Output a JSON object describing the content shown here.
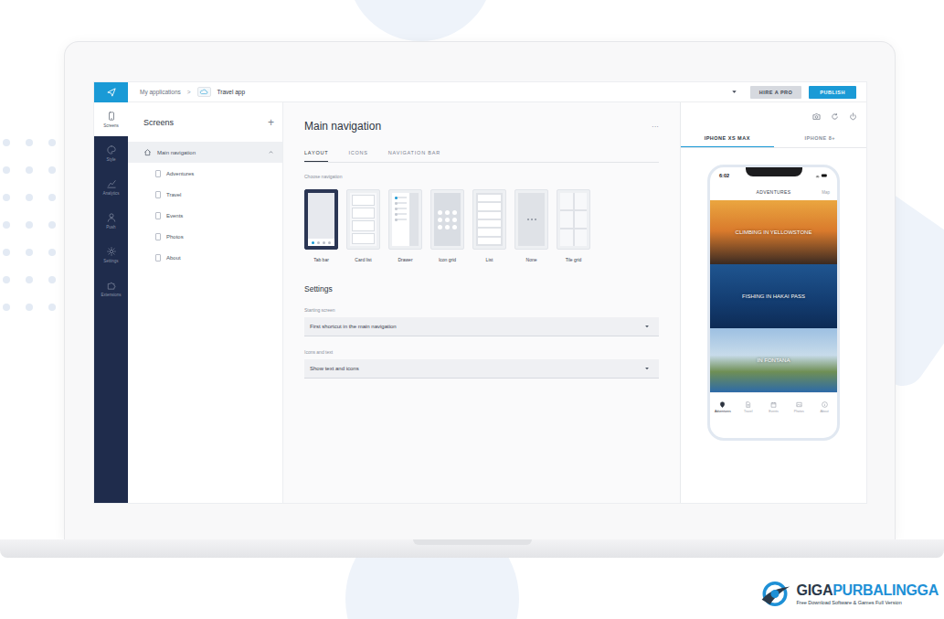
{
  "app": {
    "breadcrumb": [
      "My applications",
      "Travel app"
    ],
    "separator": ">",
    "buttons": [
      {
        "label": "HIRE A PRO",
        "kind": "secondary"
      },
      {
        "label": "PUBLISH",
        "kind": "primary"
      }
    ]
  },
  "sidebar": {
    "items": [
      {
        "label": "Screens",
        "selected": true
      },
      {
        "label": "Style",
        "selected": false
      },
      {
        "label": "Analytics",
        "selected": false
      },
      {
        "label": "Push",
        "selected": false
      },
      {
        "label": "Settings",
        "selected": false
      },
      {
        "label": "Extensions",
        "selected": false
      }
    ]
  },
  "screens": {
    "title": "Screens",
    "add": "+",
    "items": [
      {
        "label": "Main navigation",
        "kind": "root",
        "selected": true,
        "expanded": true
      },
      {
        "label": "Adventures",
        "kind": "child",
        "selected": false,
        "expanded": false
      },
      {
        "label": "Travel",
        "kind": "child",
        "selected": false,
        "expanded": false
      },
      {
        "label": "Events",
        "kind": "child",
        "selected": false,
        "expanded": false
      },
      {
        "label": "Photos",
        "kind": "child",
        "selected": false,
        "expanded": false
      },
      {
        "label": "About",
        "kind": "child",
        "selected": false,
        "expanded": false
      }
    ]
  },
  "editor": {
    "title": "Main navigation",
    "more": "···",
    "tabs": [
      {
        "label": "LAYOUT",
        "selected": true
      },
      {
        "label": "ICONS",
        "selected": false
      },
      {
        "label": "NAVIGATION BAR",
        "selected": false
      }
    ],
    "choose_label": "Choose navigation",
    "layouts": [
      {
        "label": "Tab bar",
        "kind": "tabbar",
        "selected": true
      },
      {
        "label": "Card list",
        "kind": "cardlist",
        "selected": false
      },
      {
        "label": "Drawer",
        "kind": "drawer",
        "selected": false
      },
      {
        "label": "Icon grid",
        "kind": "icongrid",
        "selected": false
      },
      {
        "label": "List",
        "kind": "list",
        "selected": false
      },
      {
        "label": "None",
        "kind": "none",
        "selected": false
      },
      {
        "label": "Tile grid",
        "kind": "tilegrid",
        "selected": false
      }
    ],
    "settings_title": "Settings",
    "fields": [
      {
        "label": "Starting screen",
        "value": "First shortcut in the main navigation"
      },
      {
        "label": "Icons and text",
        "value": "Show text and icons"
      }
    ]
  },
  "preview": {
    "devices": [
      {
        "label": "IPHONE XS MAX",
        "selected": true
      },
      {
        "label": "IPHONE 8+",
        "selected": false
      }
    ],
    "phone": {
      "time": "6:02",
      "title": "ADVENTURES",
      "action": "Map",
      "cards": [
        {
          "title": "CLIMBING IN YELLOWSTONE",
          "kind": "sunset"
        },
        {
          "title": "FISHING IN HAKAI PASS",
          "kind": "sea"
        },
        {
          "title": "IN FONTANA",
          "kind": "golf"
        }
      ],
      "tabs": [
        {
          "label": "Adventures",
          "selected": true
        },
        {
          "label": "Travel",
          "selected": false
        },
        {
          "label": "Events",
          "selected": false
        },
        {
          "label": "Photos",
          "selected": false
        },
        {
          "label": "About",
          "selected": false
        }
      ]
    }
  },
  "watermark": {
    "brand_dark": "GIGA",
    "brand_blue": "PURBALINGGA",
    "tagline": "Free Download Software & Games Full Version"
  }
}
